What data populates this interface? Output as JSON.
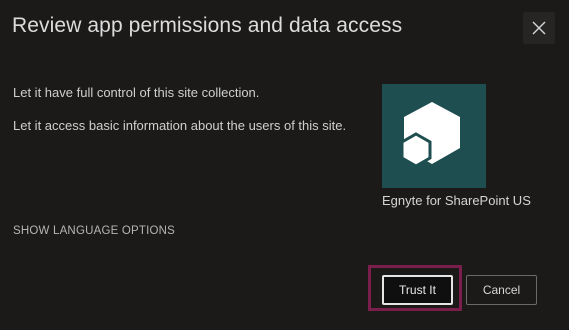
{
  "dialog": {
    "title": "Review app permissions and data access",
    "close_icon": "close-icon"
  },
  "permissions": [
    "Let it have full control of this site collection.",
    "Let it access basic information about the users of this site."
  ],
  "app": {
    "name": "Egnyte for SharePoint US",
    "icon": "egnyte-hexagon-logo-icon",
    "tile_color": "#1e4e4f"
  },
  "language_link": "SHOW LANGUAGE OPTIONS",
  "buttons": {
    "trust_label": "Trust It",
    "cancel_label": "Cancel"
  },
  "colors": {
    "background": "#1b1a19",
    "highlight": "#7a1f4b",
    "tile": "#1e4e4f"
  }
}
